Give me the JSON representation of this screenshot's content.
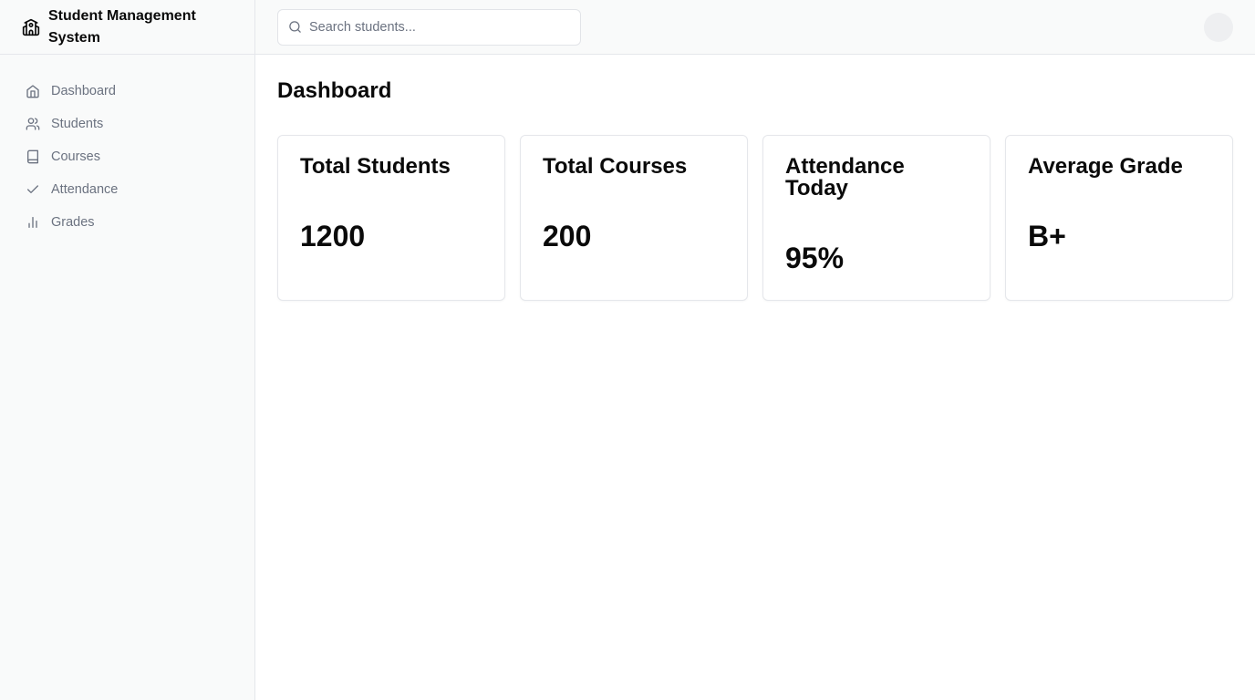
{
  "app": {
    "title": "Student Management System"
  },
  "sidebar": {
    "items": [
      {
        "label": "Dashboard",
        "icon": "home-icon"
      },
      {
        "label": "Students",
        "icon": "users-icon"
      },
      {
        "label": "Courses",
        "icon": "book-icon"
      },
      {
        "label": "Attendance",
        "icon": "check-icon"
      },
      {
        "label": "Grades",
        "icon": "bar-chart-icon"
      }
    ]
  },
  "header": {
    "search_placeholder": "Search students...",
    "search_value": ""
  },
  "main": {
    "page_title": "Dashboard",
    "cards": [
      {
        "title": "Total Students",
        "value": "1200"
      },
      {
        "title": "Total Courses",
        "value": "200"
      },
      {
        "title": "Attendance Today",
        "value": "95%"
      },
      {
        "title": "Average Grade",
        "value": "B+"
      }
    ]
  },
  "colors": {
    "sidebar_bg": "#f9fafa",
    "border": "#e5e7eb",
    "muted_text": "#6b7280",
    "text": "#0a0a0a"
  }
}
